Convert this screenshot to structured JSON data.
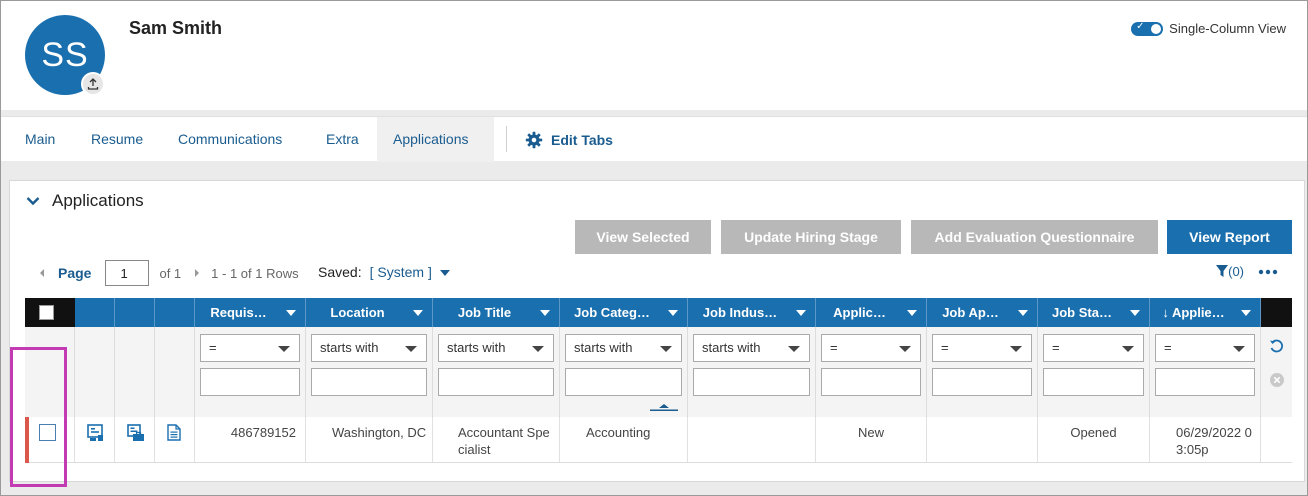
{
  "header": {
    "avatar_initials": "SS",
    "name": "Sam Smith",
    "view_toggle_label": "Single-Column View",
    "upload_icon": "upload-icon"
  },
  "tabs": [
    {
      "label": "Main"
    },
    {
      "label": "Resume"
    },
    {
      "label": "Communications"
    },
    {
      "label": "Extra"
    },
    {
      "label": "Applications",
      "active": true
    }
  ],
  "edit_tabs_label": "Edit Tabs",
  "panel": {
    "title": "Applications",
    "buttons": {
      "view_selected": "View Selected",
      "update_hiring_stage": "Update Hiring Stage",
      "add_evaluation": "Add Evaluation Questionnaire",
      "view_report": "View Report"
    },
    "pager": {
      "page_label": "Page",
      "page_value": "1",
      "of_label": "of 1",
      "rows_label": "1 - 1 of 1 Rows"
    },
    "saved_label": "Saved:",
    "saved_value": "[ System ]",
    "filter_count": "(0)",
    "more_icon": "ellipsis-icon"
  },
  "table": {
    "columns": [
      {
        "label": "Requis…",
        "filter": "="
      },
      {
        "label": "Location",
        "filter": "starts with"
      },
      {
        "label": "Job Title",
        "filter": "starts with"
      },
      {
        "label": "Job Categ…",
        "filter": "starts with"
      },
      {
        "label": "Job Indus…",
        "filter": "starts with"
      },
      {
        "label": "Applic…",
        "filter": "="
      },
      {
        "label": "Job Ap…",
        "filter": "="
      },
      {
        "label": "Job Sta…",
        "filter": "="
      },
      {
        "label": "↓ Applie…",
        "filter": "="
      }
    ],
    "rows": [
      {
        "requisition": "486789152",
        "location": "Washington, DC",
        "job_title": "Accountant Spe cialist",
        "job_title_l1": "Accountant Spe",
        "job_title_l2": "cialist",
        "job_category": "Accounting",
        "job_industry": "",
        "application_status": "New",
        "job_ap": "",
        "job_status": "Opened",
        "applied": "06/29/2022 0 3:05p",
        "applied_l1": "06/29/2022 0",
        "applied_l2": "3:05p"
      }
    ]
  },
  "colors": {
    "accent": "#1a6faf",
    "disabled_button": "#b8b8b8",
    "row_flag": "#d9584a",
    "highlight": "#c23bb3"
  }
}
